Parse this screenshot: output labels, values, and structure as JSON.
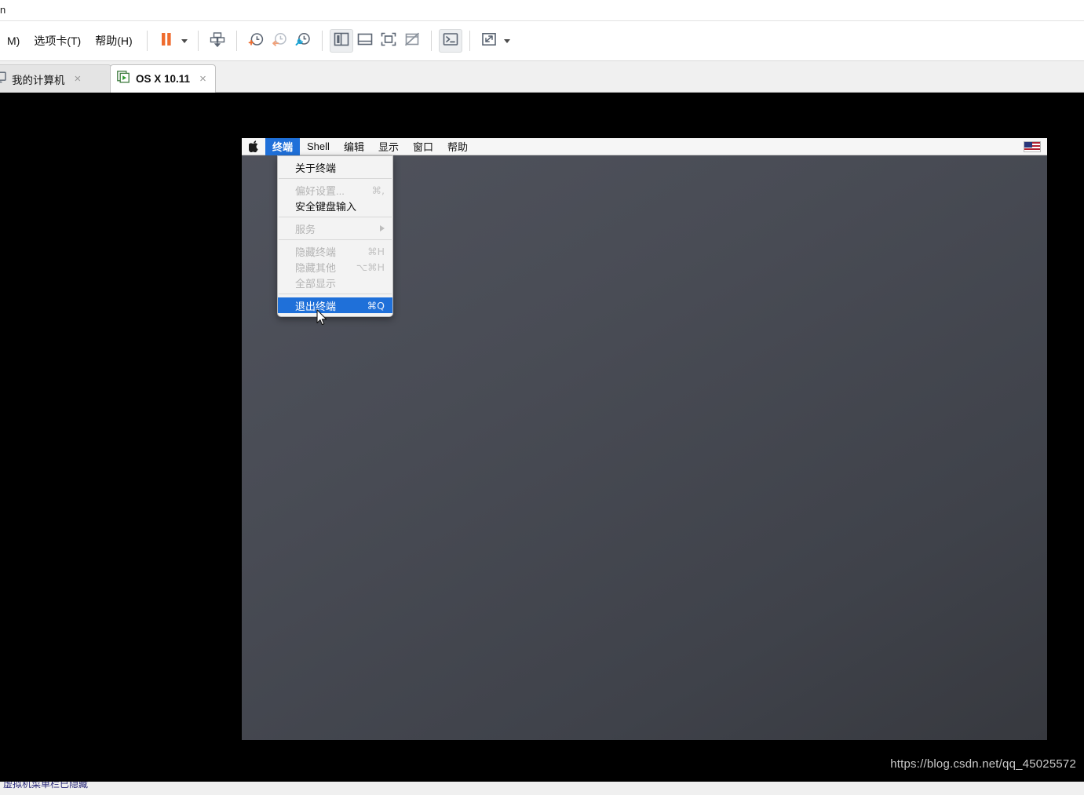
{
  "host": {
    "window_title_fragment": "n",
    "menu_items": [
      {
        "label": "M)",
        "name": "menu-vm-partial"
      },
      {
        "label": "选项卡(T)",
        "name": "menu-tabs"
      },
      {
        "label": "帮助(H)",
        "name": "menu-help"
      }
    ],
    "toolbar": [
      {
        "name": "pause-vm-button",
        "icon": "pause-icon"
      },
      {
        "name": "pause-dropdown-caret",
        "icon": "chevron-down-icon"
      },
      {
        "name": "suspend-vm-button",
        "icon": "suspend-download-icon"
      },
      {
        "name": "take-snapshot-button",
        "icon": "snapshot-add-clock-icon"
      },
      {
        "name": "revert-snapshot-button",
        "icon": "snapshot-revert-clock-icon"
      },
      {
        "name": "snapshot-manager-button",
        "icon": "snapshot-manage-clock-icon"
      },
      {
        "name": "show-library-button",
        "icon": "sidebar-panel-icon"
      },
      {
        "name": "show-thumbnail-bar-button",
        "icon": "bottom-panel-icon"
      },
      {
        "name": "fullscreen-button",
        "icon": "fullscreen-brackets-icon"
      },
      {
        "name": "unity-mode-button",
        "icon": "unity-window-slash-icon"
      },
      {
        "name": "console-view-button",
        "icon": "terminal-prompt-icon"
      },
      {
        "name": "stretch-view-button",
        "icon": "diagonal-arrows-icon"
      },
      {
        "name": "stretch-dropdown-caret",
        "icon": "chevron-down-icon"
      }
    ],
    "tabs": [
      {
        "label": "我的计算机",
        "icon": "monitor-icon",
        "active": false,
        "close": "×"
      },
      {
        "label": "OS X 10.11",
        "icon": "vm-play-icon",
        "active": true,
        "close": "×"
      }
    ]
  },
  "guest": {
    "menubar": {
      "apple_icon": "apple-logo-icon",
      "items": [
        {
          "label": "终端",
          "active": true,
          "name": "mac-menu-terminal"
        },
        {
          "label": "Shell",
          "active": false,
          "name": "mac-menu-shell"
        },
        {
          "label": "编辑",
          "active": false,
          "name": "mac-menu-edit"
        },
        {
          "label": "显示",
          "active": false,
          "name": "mac-menu-view"
        },
        {
          "label": "窗口",
          "active": false,
          "name": "mac-menu-window"
        },
        {
          "label": "帮助",
          "active": false,
          "name": "mac-menu-help"
        }
      ],
      "status_icon": "us-flag-input-source-icon"
    },
    "dropdown": {
      "title": "终端",
      "groups": [
        [
          {
            "label": "关于终端",
            "shortcut": "",
            "disabled": false,
            "selected": false,
            "submenu": false,
            "name": "menuitem-about-terminal"
          }
        ],
        [
          {
            "label": "偏好设置...",
            "shortcut": "⌘,",
            "disabled": true,
            "selected": false,
            "submenu": false,
            "name": "menuitem-preferences"
          },
          {
            "label": "安全键盘输入",
            "shortcut": "",
            "disabled": false,
            "selected": false,
            "submenu": false,
            "name": "menuitem-secure-keyboard-entry"
          }
        ],
        [
          {
            "label": "服务",
            "shortcut": "",
            "disabled": true,
            "selected": false,
            "submenu": true,
            "name": "menuitem-services"
          }
        ],
        [
          {
            "label": "隐藏终端",
            "shortcut": "⌘H",
            "disabled": true,
            "selected": false,
            "submenu": false,
            "name": "menuitem-hide-terminal"
          },
          {
            "label": "隐藏其他",
            "shortcut": "⌥⌘H",
            "disabled": true,
            "selected": false,
            "submenu": false,
            "name": "menuitem-hide-others"
          },
          {
            "label": "全部显示",
            "shortcut": "",
            "disabled": true,
            "selected": false,
            "submenu": false,
            "name": "menuitem-show-all"
          }
        ],
        [
          {
            "label": "退出终端",
            "shortcut": "⌘Q",
            "disabled": false,
            "selected": true,
            "submenu": false,
            "name": "menuitem-quit-terminal"
          }
        ]
      ]
    }
  },
  "watermark": "https://blog.csdn.net/qq_45025572",
  "bottom_strip_text": "虚拟机菜单栏已隐藏",
  "colors": {
    "accent_blue": "#1f70d9",
    "toolbar_orange": "#ef6c2e",
    "desktop_gray": "#4a4d57",
    "host_bg": "#ffffff"
  }
}
